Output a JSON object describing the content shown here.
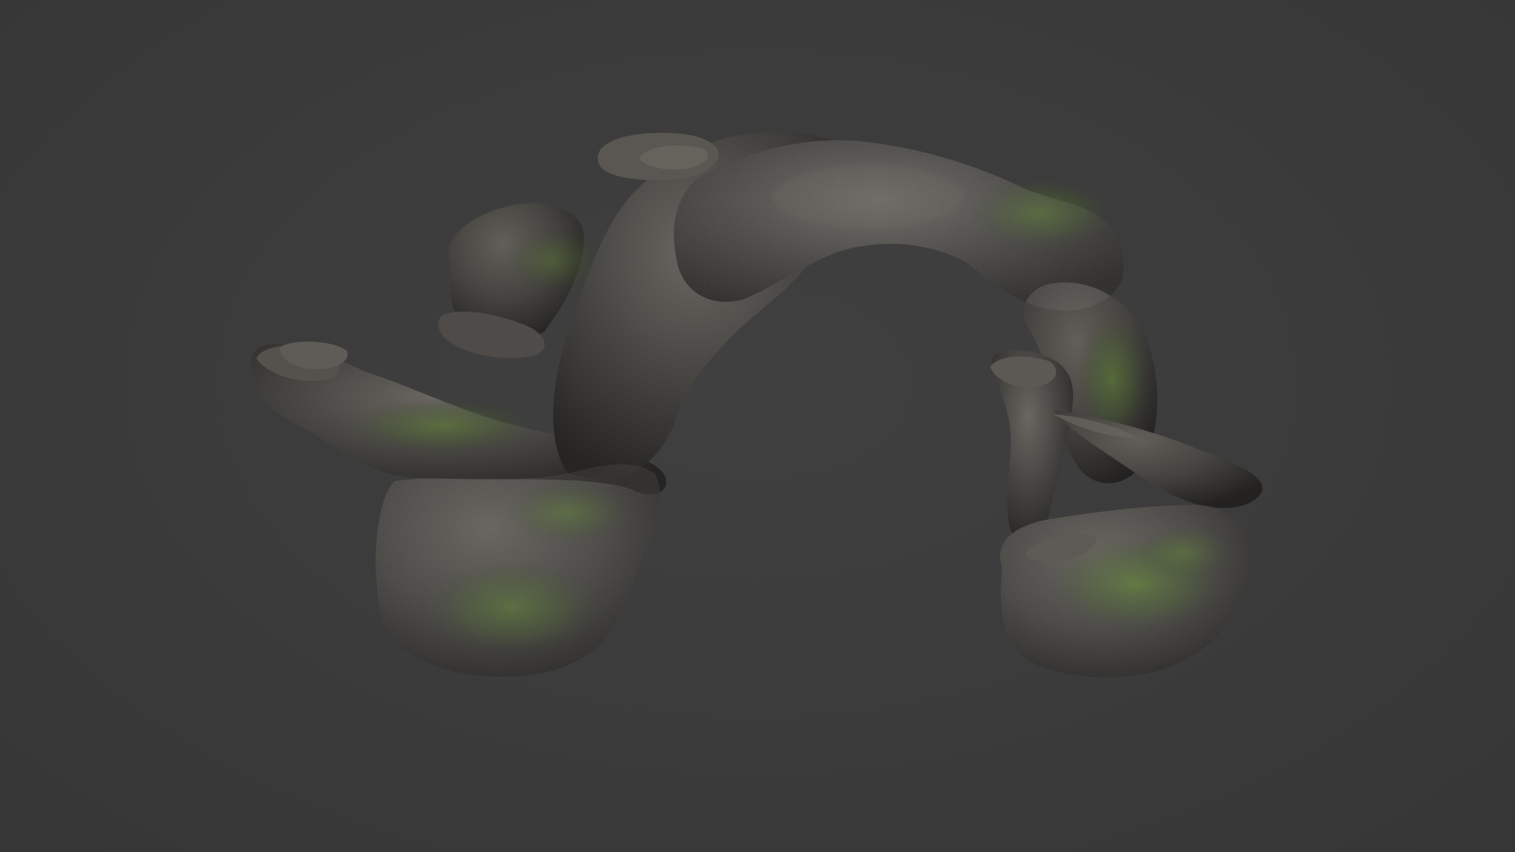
{
  "viewport": {
    "background_color": "#3a3a3a",
    "subject": "rock-arch-3d-model"
  },
  "materials": {
    "rock_base": "#4a4845",
    "rock_dark": "#2c2b29",
    "rock_highlight": "#6b6762",
    "moss": "#4f6a2a",
    "moss_bright": "#5f8a2c"
  }
}
